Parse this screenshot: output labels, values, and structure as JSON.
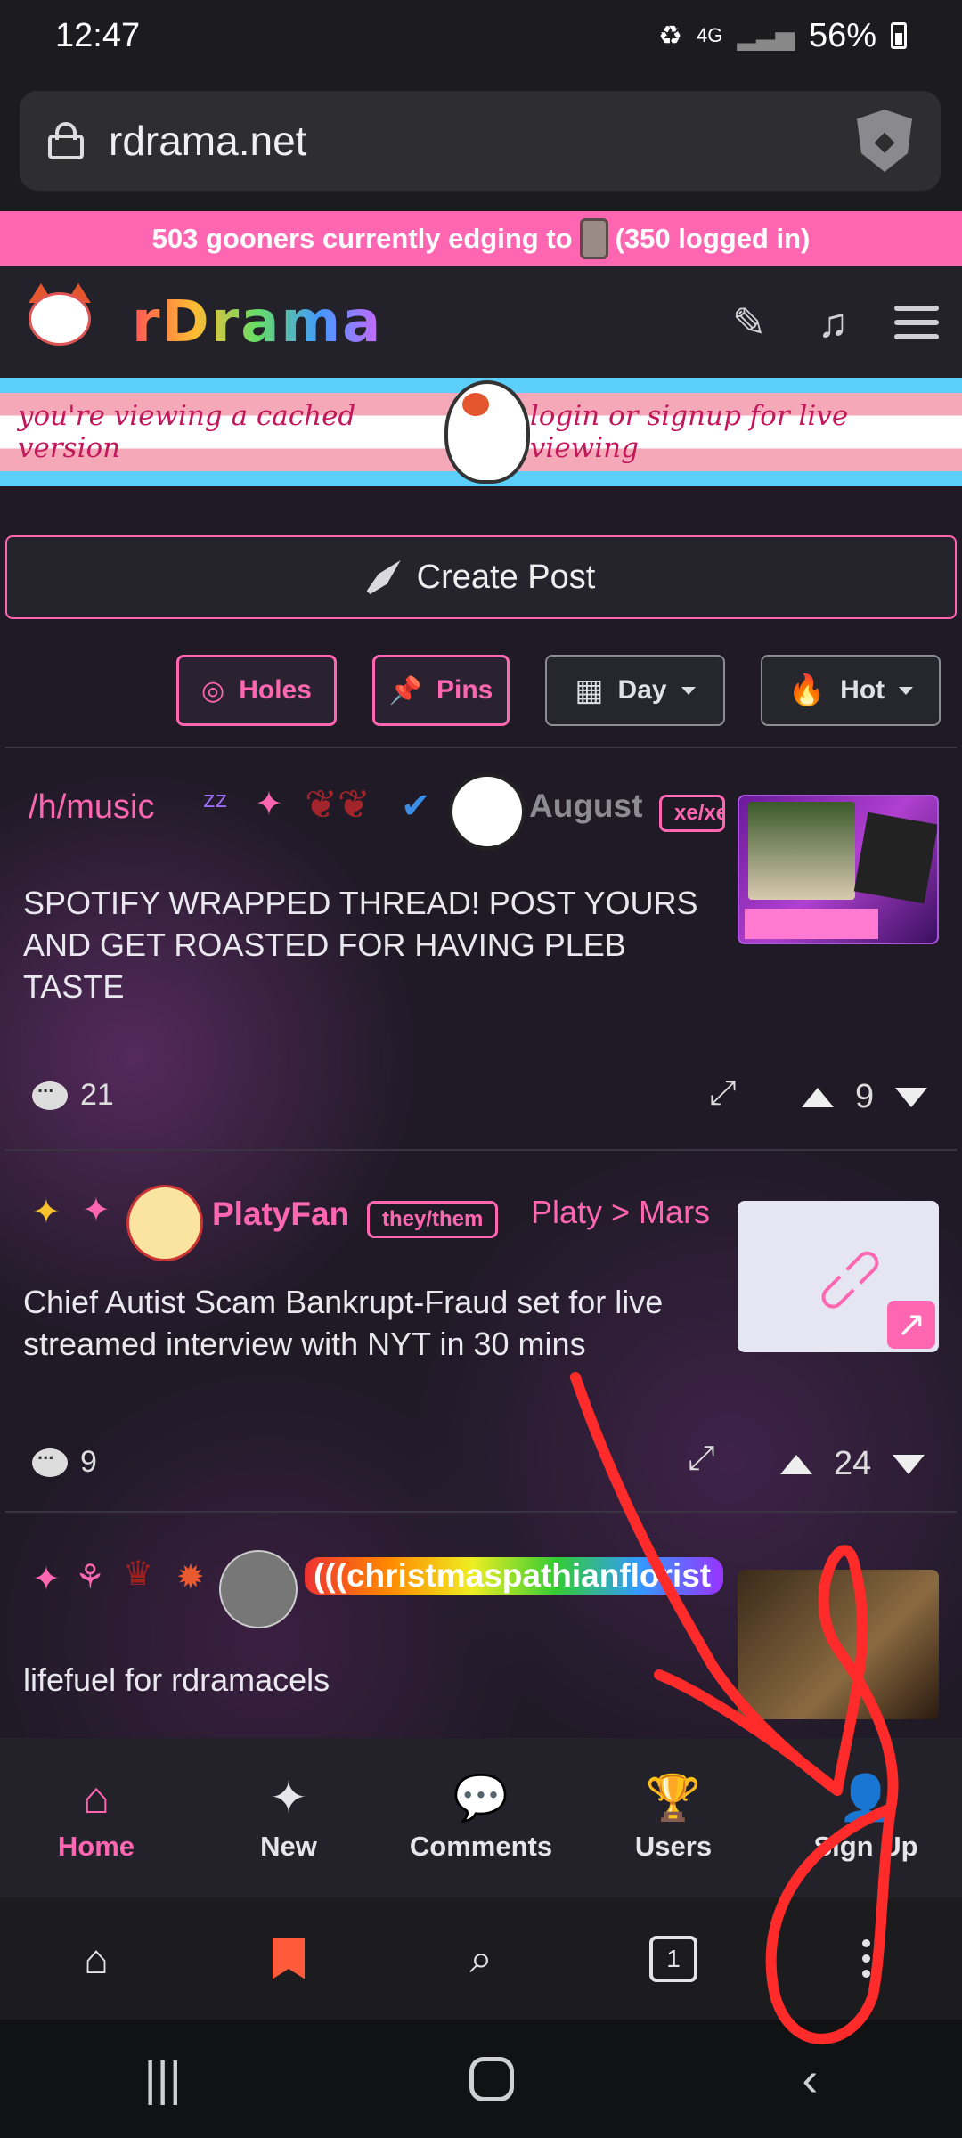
{
  "status_bar": {
    "time": "12:47",
    "network": "4G",
    "battery": "56%"
  },
  "browser": {
    "url": "rdrama.net",
    "tab_count": "1"
  },
  "site": {
    "online_banner_prefix": "503 gooners currently edging to",
    "online_banner_suffix": "(350 logged in)",
    "logo_text": "rDrama",
    "cached_left": "you're viewing a cached version",
    "cached_right": "login or signup for live viewing",
    "create_post": "Create Post",
    "filters": {
      "holes": "Holes",
      "pins": "Pins",
      "time": "Day",
      "sort": "Hot"
    }
  },
  "posts": [
    {
      "hole": "/h/music",
      "author": "August",
      "pronouns": "xe/xe",
      "title": "SPOTIFY WRAPPED THREAD! POST YOURS AND GET ROASTED FOR HAVING PLEB TASTE",
      "comments": "21",
      "score": "9"
    },
    {
      "author": "PlatyFan",
      "pronouns": "they/them",
      "flair": "Platy > Mars",
      "title": "Chief Autist Scam Bankrupt-Fraud set for live streamed interview with NYT in 30 mins",
      "comments": "9",
      "score": "24"
    },
    {
      "author": "(((christmaspathianflorist",
      "title": "lifefuel for rdramacels"
    }
  ],
  "site_nav": [
    {
      "label": "Home",
      "icon": "home-icon"
    },
    {
      "label": "New",
      "icon": "sparkles-icon"
    },
    {
      "label": "Comments",
      "icon": "comment-icon"
    },
    {
      "label": "Users",
      "icon": "trophy-icon"
    },
    {
      "label": "Sign Up",
      "icon": "user-plus-icon"
    }
  ],
  "colors": {
    "accent": "#ff66b2",
    "background": "#201a26",
    "bookmark": "#ff5b3a",
    "annotation": "#ff2a2a"
  }
}
